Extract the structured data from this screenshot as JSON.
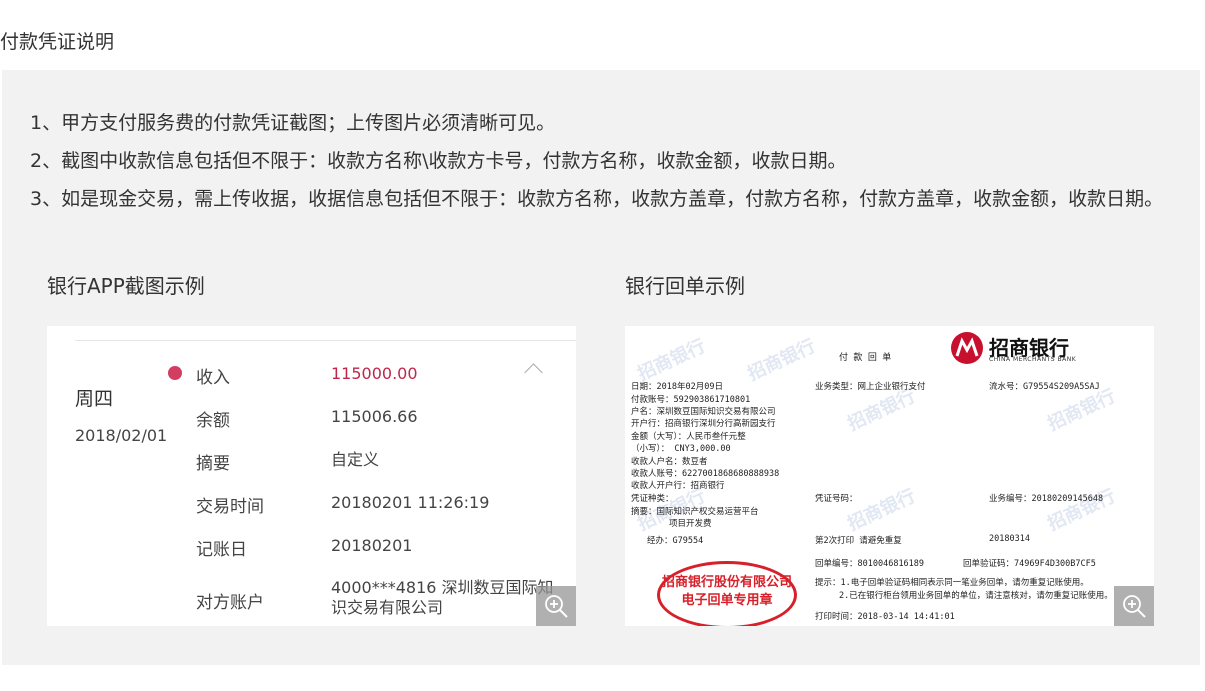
{
  "page": {
    "title": "付款凭证说明"
  },
  "rules": [
    "1、甲方支付服务费的付款凭证截图；上传图片必须清晰可见。",
    "2、截图中收款信息包括但不限于：收款方名称\\收款方卡号，付款方名称，收款金额，收款日期。",
    "3、如是现金交易，需上传收据，收据信息包括但不限于：收款方名称，收款方盖章，付款方名称，付款方盖章，收款金额，收款日期。"
  ],
  "app_example": {
    "label": "银行APP截图示例",
    "day": "周四",
    "date": "2018/02/01",
    "rows": [
      {
        "label": "收入",
        "value": "115000.00"
      },
      {
        "label": "余额",
        "value": "115006.66"
      },
      {
        "label": "摘要",
        "value": "自定义"
      },
      {
        "label": "交易时间",
        "value": "20180201 11:26:19"
      },
      {
        "label": "记账日",
        "value": "20180201"
      },
      {
        "label": "对方账户",
        "value": "4000***4816 深圳数豆国际知识交易有限公司"
      }
    ],
    "accent": "#d33d5f"
  },
  "receipt_example": {
    "label": "银行回单示例",
    "heading": "付 款 回 单",
    "bank_name": "招商银行",
    "bank_name_en": "CHINA MERCHANTS BANK",
    "watermark": "招商银行",
    "lines": {
      "date": "日期：2018年02月09日",
      "biz_type": "业务类型：网上企业银行支付",
      "serial": "流水号：G79554S209A5SAJ",
      "payer_acct": "付款账号：592903861710801",
      "payer_name": "户名：深圳数豆国际知识交易有限公司",
      "payer_bank": "开户行：招商银行深圳分行高新园支行",
      "amount_upper": "金额（大写）：人民币叁仟元整",
      "amount_lower": "（小写）：    CNY3,000.00",
      "payee_name": "收款人户名：数豆者",
      "payee_acct": "收款人账号：6227001868680888938",
      "payee_bank": "收款人开户行：招商银行",
      "voucher_type": "凭证种类：",
      "voucher_no": "凭证号码：",
      "biz_no": "业务编号：20180209145648",
      "summary": "摘要：国际知识产权交易运营平台",
      "summary2": "项目开发费",
      "operator": "经办：G79554",
      "print_count": "第2次打印 请避免重复",
      "print_date": "20180314",
      "receipt_no": "回单编号：8010046816189",
      "verify_code": "回单验证码：74969F4D300B7CF5",
      "tip1": "提示：1.电子回单验证码相同表示同一笔业务回单，请勿重复记账使用。",
      "tip2": "2.已在银行柜台领用业务回单的单位，请注意核对，请勿重复记账使用。",
      "print_time": "打印时间：2018-03-14 14:41:01"
    },
    "stamp_line1": "招商银行股份有限公司",
    "stamp_line2": "电子回单专用章",
    "stamp_color": "#d8202a",
    "brand_color": "#c8102e"
  },
  "icons": {
    "zoom": "zoom-in-icon",
    "collapse": "chevron-up-icon"
  }
}
